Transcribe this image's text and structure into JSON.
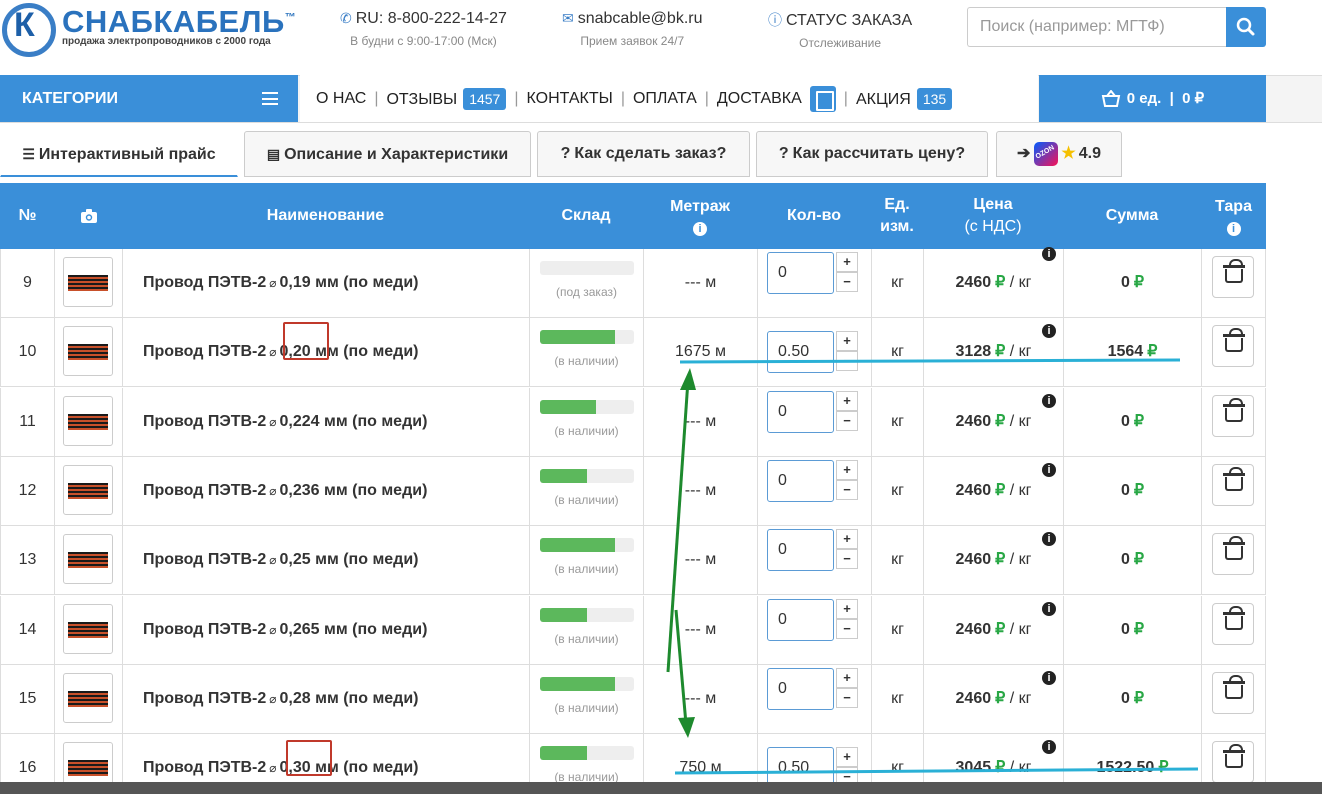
{
  "header": {
    "logo_letter": "К",
    "logo_name": "СНАБКАБЕЛЬ",
    "logo_tm": "™",
    "logo_subtitle": "продажа электропроводников с 2000 года",
    "phone": "RU: 8-800-222-14-27",
    "phone_hours": "В будни с 9:00-17:00 (Мск)",
    "email": "snabcable@bk.ru",
    "email_sub": "Прием заявок 24/7",
    "order_status": "СТАТУС ЗАКАЗА",
    "order_status_sub": "Отслеживание",
    "search_placeholder": "Поиск (например: МГТФ)"
  },
  "nav": {
    "categories": "КАТЕГОРИИ",
    "about": "О НАС",
    "reviews": "ОТЗЫВЫ",
    "reviews_count": "1457",
    "contacts": "КОНТАКТЫ",
    "payment": "ОПЛАТА",
    "delivery": "ДОСТАВКА",
    "promo": "АКЦИЯ",
    "promo_count": "135",
    "cart": "0 ед.  |  0 ₽"
  },
  "tabs": {
    "price": "Интерактивный прайс",
    "description": "Описание и Характеристики",
    "how_order": "Как сделать заказ?",
    "how_price": "Как рассчитать цену?",
    "rating": "4.9"
  },
  "table_header": {
    "num": "№",
    "name": "Наименование",
    "stock": "Склад",
    "metr": "Метраж",
    "qty": "Кол-во",
    "unit_l1": "Ед.",
    "unit_l2": "изм.",
    "price_l1": "Цена",
    "price_l2": "(с НДС)",
    "sum": "Сумма",
    "tara": "Тара"
  },
  "rows": [
    {
      "num": "9",
      "name": "Провод ПЭТВ-2",
      "diam": "0,19",
      "tail": "мм (по меди)",
      "stock": 0,
      "stock_label": "(под заказ)",
      "metr": "--- м",
      "qty": "0",
      "unit": "кг",
      "price": "2460",
      "price_unit": "/ кг",
      "sum": "0"
    },
    {
      "num": "10",
      "name": "Провод ПЭТВ-2",
      "diam": "0,20",
      "tail": "мм (по меди)",
      "stock": 0.8,
      "stock_label": "(в наличии)",
      "metr": "1675 м",
      "qty": "0.50",
      "unit": "кг",
      "price": "3128",
      "price_unit": "/ кг",
      "sum": "1564"
    },
    {
      "num": "11",
      "name": "Провод ПЭТВ-2",
      "diam": "0,224",
      "tail": "мм (по меди)",
      "stock": 0.6,
      "stock_label": "(в наличии)",
      "metr": "--- м",
      "qty": "0",
      "unit": "кг",
      "price": "2460",
      "price_unit": "/ кг",
      "sum": "0"
    },
    {
      "num": "12",
      "name": "Провод ПЭТВ-2",
      "diam": "0,236",
      "tail": "мм (по меди)",
      "stock": 0.5,
      "stock_label": "(в наличии)",
      "metr": "--- м",
      "qty": "0",
      "unit": "кг",
      "price": "2460",
      "price_unit": "/ кг",
      "sum": "0"
    },
    {
      "num": "13",
      "name": "Провод ПЭТВ-2",
      "diam": "0,25",
      "tail": "мм (по меди)",
      "stock": 0.8,
      "stock_label": "(в наличии)",
      "metr": "--- м",
      "qty": "0",
      "unit": "кг",
      "price": "2460",
      "price_unit": "/ кг",
      "sum": "0"
    },
    {
      "num": "14",
      "name": "Провод ПЭТВ-2",
      "diam": "0,265",
      "tail": "мм (по меди)",
      "stock": 0.5,
      "stock_label": "(в наличии)",
      "metr": "--- м",
      "qty": "0",
      "unit": "кг",
      "price": "2460",
      "price_unit": "/ кг",
      "sum": "0"
    },
    {
      "num": "15",
      "name": "Провод ПЭТВ-2",
      "diam": "0,28",
      "tail": "мм (по меди)",
      "stock": 0.8,
      "stock_label": "(в наличии)",
      "metr": "--- м",
      "qty": "0",
      "unit": "кг",
      "price": "2460",
      "price_unit": "/ кг",
      "sum": "0"
    },
    {
      "num": "16",
      "name": "Провод ПЭТВ-2",
      "diam": "0,30",
      "tail": "мм (по меди)",
      "stock": 0.5,
      "stock_label": "(в наличии)",
      "metr": "750 м",
      "qty": "0.50",
      "unit": "кг",
      "price": "3045",
      "price_unit": "/ кг",
      "sum": "1522.50"
    }
  ],
  "currency": "₽",
  "colors": {
    "accent": "#3a8fd9",
    "ruble": "#28a745",
    "stock": "#5cb85c",
    "annotation_blue": "#2ab0d6",
    "annotation_green": "#1e8a2e",
    "annotation_red": "#c0392b"
  }
}
